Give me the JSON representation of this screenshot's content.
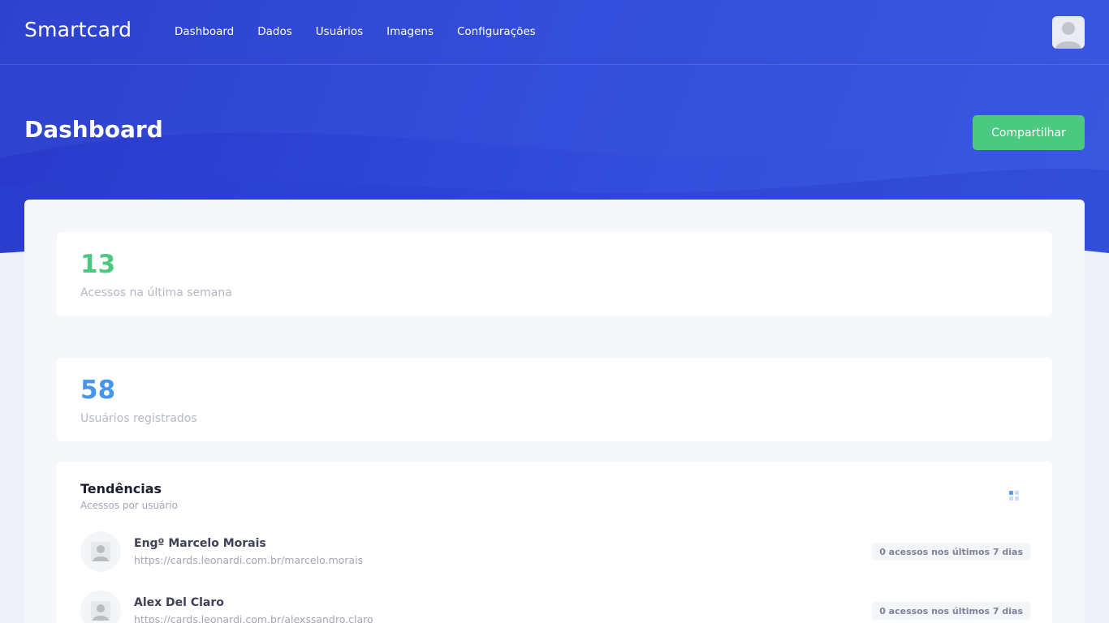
{
  "app": {
    "brand": "Smartcard"
  },
  "nav": {
    "items": [
      {
        "label": "Dashboard"
      },
      {
        "label": "Dados"
      },
      {
        "label": "Usuários"
      },
      {
        "label": "Imagens"
      },
      {
        "label": "Configurações"
      }
    ]
  },
  "header": {
    "title": "Dashboard",
    "share_label": "Compartilhar"
  },
  "stats": [
    {
      "value": "13",
      "label": "Acessos na última semana",
      "color": "#4cc980"
    },
    {
      "value": "58",
      "label": "Usuários registrados",
      "color": "#4497ea"
    }
  ],
  "trends": {
    "title": "Tendências",
    "subtitle": "Acessos por usuário",
    "menu_icon": "grid-dots-icon",
    "users": [
      {
        "name": "Engº Marcelo Morais",
        "url": "https://cards.leonardi.com.br/marcelo.morais",
        "badge": "0 acessos nos últimos 7 dias"
      },
      {
        "name": "Alex Del Claro",
        "url": "https://cards.leonardi.com.br/alexssandro.claro",
        "badge": "0 acessos nos últimos 7 dias"
      }
    ]
  },
  "colors": {
    "header_blue": "#3049d8",
    "accent_green": "#4cc980",
    "accent_blue": "#4497ea"
  }
}
